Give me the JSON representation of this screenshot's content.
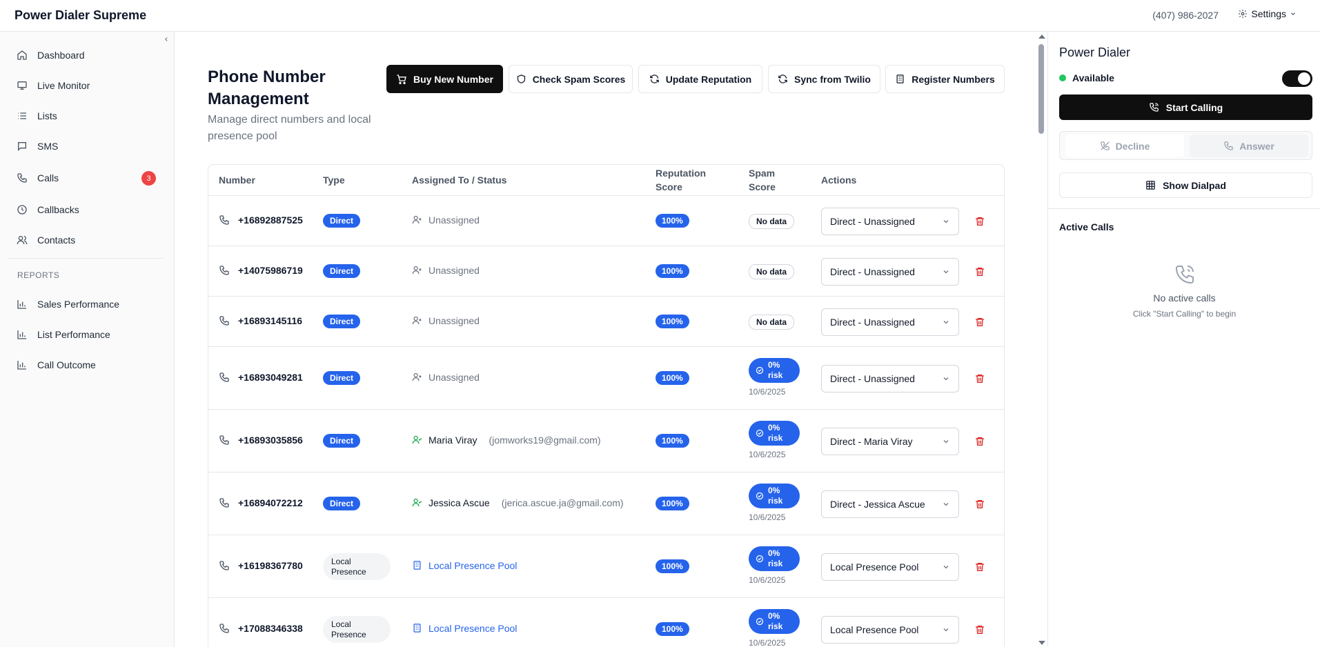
{
  "app": {
    "title": "Power Dialer Supreme",
    "phone": "(407) 986-2027",
    "settings_label": "Settings"
  },
  "sidebar": {
    "items": [
      {
        "label": "Dashboard",
        "icon": "home-icon"
      },
      {
        "label": "Live Monitor",
        "icon": "monitor-icon"
      },
      {
        "label": "Lists",
        "icon": "list-icon"
      },
      {
        "label": "SMS",
        "icon": "message-icon"
      },
      {
        "label": "Calls",
        "icon": "phone-icon",
        "badge": "3"
      },
      {
        "label": "Callbacks",
        "icon": "clock-icon"
      },
      {
        "label": "Contacts",
        "icon": "users-icon"
      }
    ],
    "reports_heading": "REPORTS",
    "reports": [
      {
        "label": "Sales Performance",
        "icon": "bar-chart-icon"
      },
      {
        "label": "List Performance",
        "icon": "bar-chart-icon"
      },
      {
        "label": "Call Outcome",
        "icon": "bar-chart-icon"
      }
    ]
  },
  "page": {
    "title": "Phone Number Management",
    "subtitle": "Manage direct numbers and local presence pool",
    "buttons": {
      "buy": "Buy New Number",
      "spam": "Check Spam Scores",
      "reputation": "Update Reputation",
      "sync": "Sync from Twilio",
      "register": "Register Numbers"
    }
  },
  "table": {
    "headers": {
      "number": "Number",
      "type": "Type",
      "assigned": "Assigned To / Status",
      "reputation": "Reputation Score",
      "spam": "Spam Score",
      "actions": "Actions"
    },
    "rows": [
      {
        "number": "+16892887525",
        "type": "Direct",
        "assigned": "Unassigned",
        "email": "",
        "reputation": "100%",
        "spam": "No data",
        "spam_date": "",
        "action": "Direct - Unassigned"
      },
      {
        "number": "+14075986719",
        "type": "Direct",
        "assigned": "Unassigned",
        "email": "",
        "reputation": "100%",
        "spam": "No data",
        "spam_date": "",
        "action": "Direct - Unassigned"
      },
      {
        "number": "+16893145116",
        "type": "Direct",
        "assigned": "Unassigned",
        "email": "",
        "reputation": "100%",
        "spam": "No data",
        "spam_date": "",
        "action": "Direct - Unassigned"
      },
      {
        "number": "+16893049281",
        "type": "Direct",
        "assigned": "Unassigned",
        "email": "",
        "reputation": "100%",
        "spam": "0% risk",
        "spam_date": "10/6/2025",
        "action": "Direct - Unassigned"
      },
      {
        "number": "+16893035856",
        "type": "Direct",
        "assigned": "Maria Viray",
        "email": "(jomworks19@gmail.com)",
        "reputation": "100%",
        "spam": "0% risk",
        "spam_date": "10/6/2025",
        "action": "Direct - Maria Viray"
      },
      {
        "number": "+16894072212",
        "type": "Direct",
        "assigned": "Jessica Ascue",
        "email": "(jerica.ascue.ja@gmail.com)",
        "reputation": "100%",
        "spam": "0% risk",
        "spam_date": "10/6/2025",
        "action": "Direct - Jessica Ascue"
      },
      {
        "number": "+16198367780",
        "type": "Local Presence",
        "assigned": "Local Presence Pool",
        "email": "",
        "reputation": "100%",
        "spam": "0% risk",
        "spam_date": "10/6/2025",
        "action": "Local Presence Pool"
      },
      {
        "number": "+17088346338",
        "type": "Local Presence",
        "assigned": "Local Presence Pool",
        "email": "",
        "reputation": "100%",
        "spam": "0% risk",
        "spam_date": "10/6/2025",
        "action": "Local Presence Pool"
      }
    ]
  },
  "dialer": {
    "title": "Power Dialer",
    "status": "Available",
    "toggle_on": true,
    "start_label": "Start Calling",
    "decline_label": "Decline",
    "answer_label": "Answer",
    "dialpad_label": "Show Dialpad",
    "active_heading": "Active Calls",
    "empty_title": "No active calls",
    "empty_sub": "Click \"Start Calling\" to begin"
  },
  "colors": {
    "accent": "#2563eb",
    "danger": "#dc2626",
    "success": "#22c55e",
    "primary": "#0f0f0f"
  }
}
